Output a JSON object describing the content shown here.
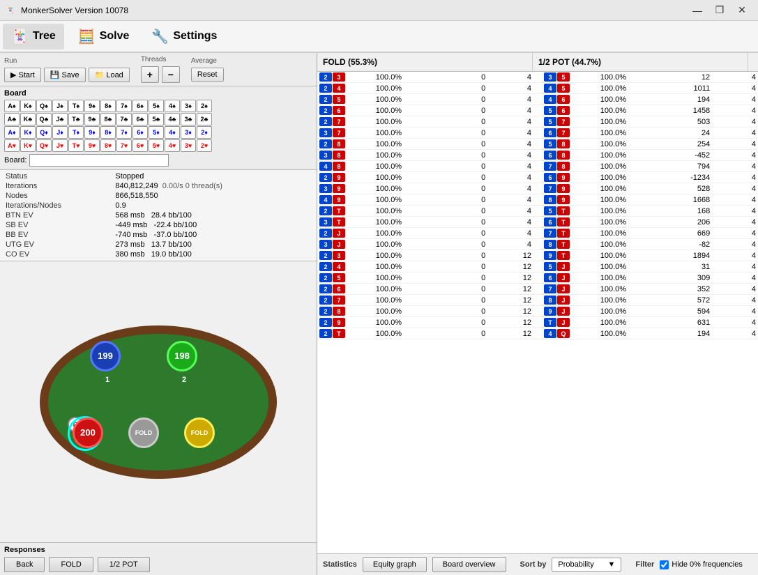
{
  "titleBar": {
    "icon": "🃏",
    "title": "MonkerSolver Version 10078",
    "minimizeLabel": "—",
    "restoreLabel": "❐",
    "closeLabel": "✕"
  },
  "menuBar": {
    "items": [
      {
        "id": "tree",
        "icon": "🃏",
        "label": "Tree"
      },
      {
        "id": "solve",
        "icon": "🧮",
        "label": "Solve"
      },
      {
        "id": "settings",
        "icon": "🔧",
        "label": "Settings"
      }
    ]
  },
  "controls": {
    "runLabel": "Run",
    "startLabel": "▶ Start",
    "saveLabel": "💾 Save",
    "loadLabel": "📁 Load",
    "threadsLabel": "Threads",
    "plusLabel": "+",
    "minusLabel": "−",
    "averageLabel": "Average",
    "resetLabel": "Reset"
  },
  "board": {
    "label": "Board",
    "inputPlaceholder": "",
    "rows": [
      [
        "A♠",
        "K♠",
        "Q♠",
        "J♠",
        "T♠",
        "9♠",
        "8♠",
        "7♠",
        "6♠",
        "5♠",
        "4♠",
        "3♠",
        "2♠"
      ],
      [
        "A♣",
        "K♣",
        "Q♣",
        "J♣",
        "T♣",
        "9♣",
        "8♣",
        "7♣",
        "6♣",
        "5♣",
        "4♣",
        "3♣",
        "2♣"
      ],
      [
        "A♦",
        "K♦",
        "Q♦",
        "J♦",
        "T♦",
        "9♦",
        "8♦",
        "7♦",
        "6♦",
        "5♦",
        "4♦",
        "3♦",
        "2♦"
      ],
      [
        "A♥",
        "K♥",
        "Q♥",
        "J♥",
        "T♥",
        "9♥",
        "8♥",
        "7♥",
        "6♥",
        "5♥",
        "4♥",
        "3♥",
        "2♥"
      ]
    ],
    "suits": [
      "spade",
      "club",
      "diamond",
      "heart"
    ]
  },
  "stats": {
    "statusLabel": "Status",
    "statusValue": "Stopped",
    "iterationsLabel": "Iterations",
    "iterationsValue": "840,812,249",
    "iterationsRate": "0.00/s 0 thread(s)",
    "nodesLabel": "Nodes",
    "nodesValue": "866,518,550",
    "iterNodesLabel": "Iterations/Nodes",
    "iterNodesValue": "0.9",
    "btnEvLabel": "BTN EV",
    "btnEvValue": "568 msb",
    "btnEvBb": "28.4 bb/100",
    "sbEvLabel": "SB EV",
    "sbEvValue": "-449 msb",
    "sbEvBb": "-22.4 bb/100",
    "bbEvLabel": "BB EV",
    "bbEvValue": "-740 msb",
    "bbEvBb": "-37.0 bb/100",
    "utbEvLabel": "UTG EV",
    "utbEvValue": "273 msb",
    "utbEvBb": "13.7 bb/100",
    "coEvLabel": "CO EV",
    "coEvValue": "380 msb",
    "coEvBb": "19.0 bb/100"
  },
  "pokerTable": {
    "chip1": {
      "value": "199",
      "label": "1",
      "color": "blue"
    },
    "chip2": {
      "value": "198",
      "label": "2",
      "color": "green"
    },
    "chip3": {
      "value": "200",
      "label": "",
      "color": "red"
    },
    "chip4": {
      "value": "FOLD",
      "label": "",
      "color": "gray"
    },
    "chip5": {
      "value": "FOLD",
      "label": "",
      "color": "yellow"
    },
    "dealerLabel": "D"
  },
  "responses": {
    "label": "Responses",
    "buttons": [
      "Back",
      "FOLD",
      "1/2 POT"
    ]
  },
  "actionHeaders": {
    "fold": "FOLD (55.3%)",
    "halfpot": "1/2 POT (44.7%)"
  },
  "tableData": [
    {
      "h1": [
        "2",
        "3"
      ],
      "h1c": [
        "blue",
        "red"
      ],
      "p1": "100.0%",
      "v1a": "0",
      "v1b": "4",
      "h2": [
        "3",
        "5"
      ],
      "h2c": [
        "blue",
        "red"
      ],
      "p2": "100.0%",
      "v2a": "12",
      "v2b": "4"
    },
    {
      "h1": [
        "2",
        "4"
      ],
      "h1c": [
        "blue",
        "red"
      ],
      "p1": "100.0%",
      "v1a": "0",
      "v1b": "4",
      "h2": [
        "4",
        "5"
      ],
      "h2c": [
        "blue",
        "red"
      ],
      "p2": "100.0%",
      "v2a": "1011",
      "v2b": "4"
    },
    {
      "h1": [
        "2",
        "5"
      ],
      "h1c": [
        "blue",
        "red"
      ],
      "p1": "100.0%",
      "v1a": "0",
      "v1b": "4",
      "h2": [
        "4",
        "6"
      ],
      "h2c": [
        "blue",
        "red"
      ],
      "p2": "100.0%",
      "v2a": "194",
      "v2b": "4"
    },
    {
      "h1": [
        "2",
        "6"
      ],
      "h1c": [
        "blue",
        "red"
      ],
      "p1": "100.0%",
      "v1a": "0",
      "v1b": "4",
      "h2": [
        "5",
        "6"
      ],
      "h2c": [
        "blue",
        "red"
      ],
      "p2": "100.0%",
      "v2a": "1458",
      "v2b": "4"
    },
    {
      "h1": [
        "2",
        "7"
      ],
      "h1c": [
        "blue",
        "red"
      ],
      "p1": "100.0%",
      "v1a": "0",
      "v1b": "4",
      "h2": [
        "5",
        "7"
      ],
      "h2c": [
        "blue",
        "red"
      ],
      "p2": "100.0%",
      "v2a": "503",
      "v2b": "4"
    },
    {
      "h1": [
        "3",
        "7"
      ],
      "h1c": [
        "blue",
        "red"
      ],
      "p1": "100.0%",
      "v1a": "0",
      "v1b": "4",
      "h2": [
        "6",
        "7"
      ],
      "h2c": [
        "blue",
        "red"
      ],
      "p2": "100.0%",
      "v2a": "24",
      "v2b": "4"
    },
    {
      "h1": [
        "2",
        "8"
      ],
      "h1c": [
        "blue",
        "red"
      ],
      "p1": "100.0%",
      "v1a": "0",
      "v1b": "4",
      "h2": [
        "5",
        "8"
      ],
      "h2c": [
        "blue",
        "red"
      ],
      "p2": "100.0%",
      "v2a": "254",
      "v2b": "4"
    },
    {
      "h1": [
        "3",
        "8"
      ],
      "h1c": [
        "blue",
        "red"
      ],
      "p1": "100.0%",
      "v1a": "0",
      "v1b": "4",
      "h2": [
        "6",
        "8"
      ],
      "h2c": [
        "blue",
        "red"
      ],
      "p2": "100.0%",
      "v2a": "-452",
      "v2b": "4"
    },
    {
      "h1": [
        "4",
        "8"
      ],
      "h1c": [
        "blue",
        "red"
      ],
      "p1": "100.0%",
      "v1a": "0",
      "v1b": "4",
      "h2": [
        "7",
        "8"
      ],
      "h2c": [
        "blue",
        "red"
      ],
      "p2": "100.0%",
      "v2a": "794",
      "v2b": "4"
    },
    {
      "h1": [
        "2",
        "9"
      ],
      "h1c": [
        "blue",
        "red"
      ],
      "p1": "100.0%",
      "v1a": "0",
      "v1b": "4",
      "h2": [
        "6",
        "9"
      ],
      "h2c": [
        "blue",
        "red"
      ],
      "p2": "100.0%",
      "v2a": "-1234",
      "v2b": "4"
    },
    {
      "h1": [
        "3",
        "9"
      ],
      "h1c": [
        "blue",
        "red"
      ],
      "p1": "100.0%",
      "v1a": "0",
      "v1b": "4",
      "h2": [
        "7",
        "9"
      ],
      "h2c": [
        "blue",
        "red"
      ],
      "p2": "100.0%",
      "v2a": "528",
      "v2b": "4"
    },
    {
      "h1": [
        "4",
        "9"
      ],
      "h1c": [
        "blue",
        "red"
      ],
      "p1": "100.0%",
      "v1a": "0",
      "v1b": "4",
      "h2": [
        "8",
        "9"
      ],
      "h2c": [
        "blue",
        "red"
      ],
      "p2": "100.0%",
      "v2a": "1668",
      "v2b": "4"
    },
    {
      "h1": [
        "2",
        "T"
      ],
      "h1c": [
        "blue",
        "red"
      ],
      "p1": "100.0%",
      "v1a": "0",
      "v1b": "4",
      "h2": [
        "5",
        "T"
      ],
      "h2c": [
        "blue",
        "red"
      ],
      "p2": "100.0%",
      "v2a": "168",
      "v2b": "4"
    },
    {
      "h1": [
        "3",
        "T"
      ],
      "h1c": [
        "blue",
        "red"
      ],
      "p1": "100.0%",
      "v1a": "0",
      "v1b": "4",
      "h2": [
        "6",
        "T"
      ],
      "h2c": [
        "blue",
        "red"
      ],
      "p2": "100.0%",
      "v2a": "206",
      "v2b": "4"
    },
    {
      "h1": [
        "2",
        "J"
      ],
      "h1c": [
        "blue",
        "red"
      ],
      "p1": "100.0%",
      "v1a": "0",
      "v1b": "4",
      "h2": [
        "7",
        "T"
      ],
      "h2c": [
        "blue",
        "red"
      ],
      "p2": "100.0%",
      "v2a": "669",
      "v2b": "4"
    },
    {
      "h1": [
        "3",
        "J"
      ],
      "h1c": [
        "blue",
        "red"
      ],
      "p1": "100.0%",
      "v1a": "0",
      "v1b": "4",
      "h2": [
        "8",
        "T"
      ],
      "h2c": [
        "blue",
        "red"
      ],
      "p2": "100.0%",
      "v2a": "-82",
      "v2b": "4"
    },
    {
      "h1": [
        "2",
        "3"
      ],
      "h1c": [
        "blue",
        "red"
      ],
      "p1": "100.0%",
      "v1a": "0",
      "v1b": "12",
      "h2": [
        "9",
        "T"
      ],
      "h2c": [
        "blue",
        "red"
      ],
      "p2": "100.0%",
      "v2a": "1894",
      "v2b": "4"
    },
    {
      "h1": [
        "2",
        "4"
      ],
      "h1c": [
        "blue",
        "red"
      ],
      "p1": "100.0%",
      "v1a": "0",
      "v1b": "12",
      "h2": [
        "5",
        "J"
      ],
      "h2c": [
        "blue",
        "red"
      ],
      "p2": "100.0%",
      "v2a": "31",
      "v2b": "4"
    },
    {
      "h1": [
        "2",
        "5"
      ],
      "h1c": [
        "blue",
        "red"
      ],
      "p1": "100.0%",
      "v1a": "0",
      "v1b": "12",
      "h2": [
        "6",
        "J"
      ],
      "h2c": [
        "blue",
        "red"
      ],
      "p2": "100.0%",
      "v2a": "309",
      "v2b": "4"
    },
    {
      "h1": [
        "2",
        "6"
      ],
      "h1c": [
        "blue",
        "red"
      ],
      "p1": "100.0%",
      "v1a": "0",
      "v1b": "12",
      "h2": [
        "7",
        "J"
      ],
      "h2c": [
        "blue",
        "red"
      ],
      "p2": "100.0%",
      "v2a": "352",
      "v2b": "4"
    },
    {
      "h1": [
        "2",
        "7"
      ],
      "h1c": [
        "blue",
        "red"
      ],
      "p1": "100.0%",
      "v1a": "0",
      "v1b": "12",
      "h2": [
        "8",
        "J"
      ],
      "h2c": [
        "blue",
        "red"
      ],
      "p2": "100.0%",
      "v2a": "572",
      "v2b": "4"
    },
    {
      "h1": [
        "2",
        "8"
      ],
      "h1c": [
        "blue",
        "red"
      ],
      "p1": "100.0%",
      "v1a": "0",
      "v1b": "12",
      "h2": [
        "9",
        "J"
      ],
      "h2c": [
        "blue",
        "red"
      ],
      "p2": "100.0%",
      "v2a": "594",
      "v2b": "4"
    },
    {
      "h1": [
        "2",
        "9"
      ],
      "h1c": [
        "blue",
        "red"
      ],
      "p1": "100.0%",
      "v1a": "0",
      "v1b": "12",
      "h2": [
        "T",
        "J"
      ],
      "h2c": [
        "blue",
        "red"
      ],
      "p2": "100.0%",
      "v2a": "631",
      "v2b": "4"
    },
    {
      "h1": [
        "2",
        "T"
      ],
      "h1c": [
        "blue",
        "red"
      ],
      "p1": "100.0%",
      "v1a": "0",
      "v1b": "12",
      "h2": [
        "4",
        "Q"
      ],
      "h2c": [
        "blue",
        "red"
      ],
      "p2": "100.0%",
      "v2a": "194",
      "v2b": "4"
    }
  ],
  "bottomBar": {
    "statisticsLabel": "Statistics",
    "equityGraphLabel": "Equity graph",
    "boardOverviewLabel": "Board overview",
    "sortByLabel": "Sort by",
    "sortByValue": "Probability",
    "filterLabel": "Filter",
    "hideZeroLabel": "Hide 0% frequencies",
    "hideZeroChecked": true
  }
}
